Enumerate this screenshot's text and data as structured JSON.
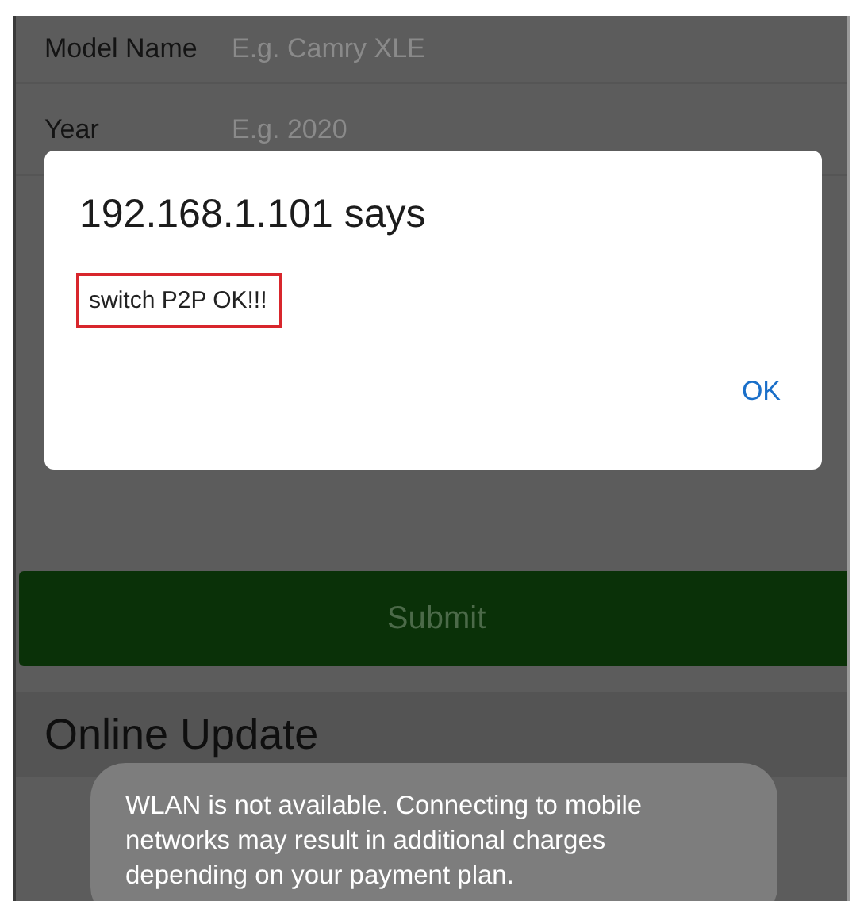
{
  "form": {
    "fields": [
      {
        "label": "Model Name",
        "placeholder": "E.g. Camry XLE"
      },
      {
        "label": "Year",
        "placeholder": "E.g. 2020"
      }
    ],
    "submit": "Submit"
  },
  "section": {
    "title": "Online Update"
  },
  "dialog": {
    "title": "192.168.1.101 says",
    "message": "switch P2P OK!!!",
    "highlighted": true,
    "button": "OK"
  },
  "toast": {
    "text": "WLAN is not available. Connecting to mobile networks may result in additional charges depending on your payment plan."
  }
}
